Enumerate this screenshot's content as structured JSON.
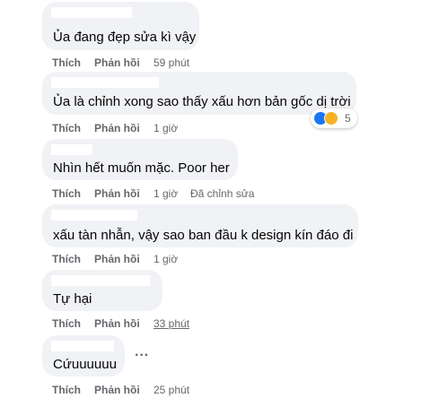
{
  "comments": [
    {
      "text": "Ủa đang đẹp sửa kì vậy",
      "like": "Thích",
      "reply": "Phản hồi",
      "time": "59 phút",
      "edited": ""
    },
    {
      "text": "Ủa là chỉnh xong sao thấy xấu hơn bản gốc dị trời",
      "like": "Thích",
      "reply": "Phản hồi",
      "time": "1 giờ",
      "edited": "",
      "reaction_count": "5"
    },
    {
      "text": "Nhìn hết muốn mặc. Poor her",
      "like": "Thích",
      "reply": "Phản hồi",
      "time": "1 giờ",
      "edited": "Đã chỉnh sửa"
    },
    {
      "text": "xấu tàn nhẫn, vậy sao ban đầu k design kín đáo đi",
      "like": "Thích",
      "reply": "Phản hồi",
      "time": "1 giờ",
      "edited": ""
    },
    {
      "text": "Tự hại",
      "like": "Thích",
      "reply": "Phản hồi",
      "time": "33 phút",
      "edited": ""
    },
    {
      "text": "Cứuuuuuu",
      "like": "Thích",
      "reply": "Phản hồi",
      "time": "25 phút",
      "edited": ""
    }
  ],
  "colors": {
    "bubble": "#f0f2f5",
    "text": "#050505",
    "meta": "#65676b",
    "like_reaction": "#1877f2",
    "haha_reaction": "#f7b125"
  },
  "icons": {
    "like_reaction": "like-reaction-icon",
    "haha_reaction": "haha-reaction-icon",
    "more": "more-options-icon"
  }
}
